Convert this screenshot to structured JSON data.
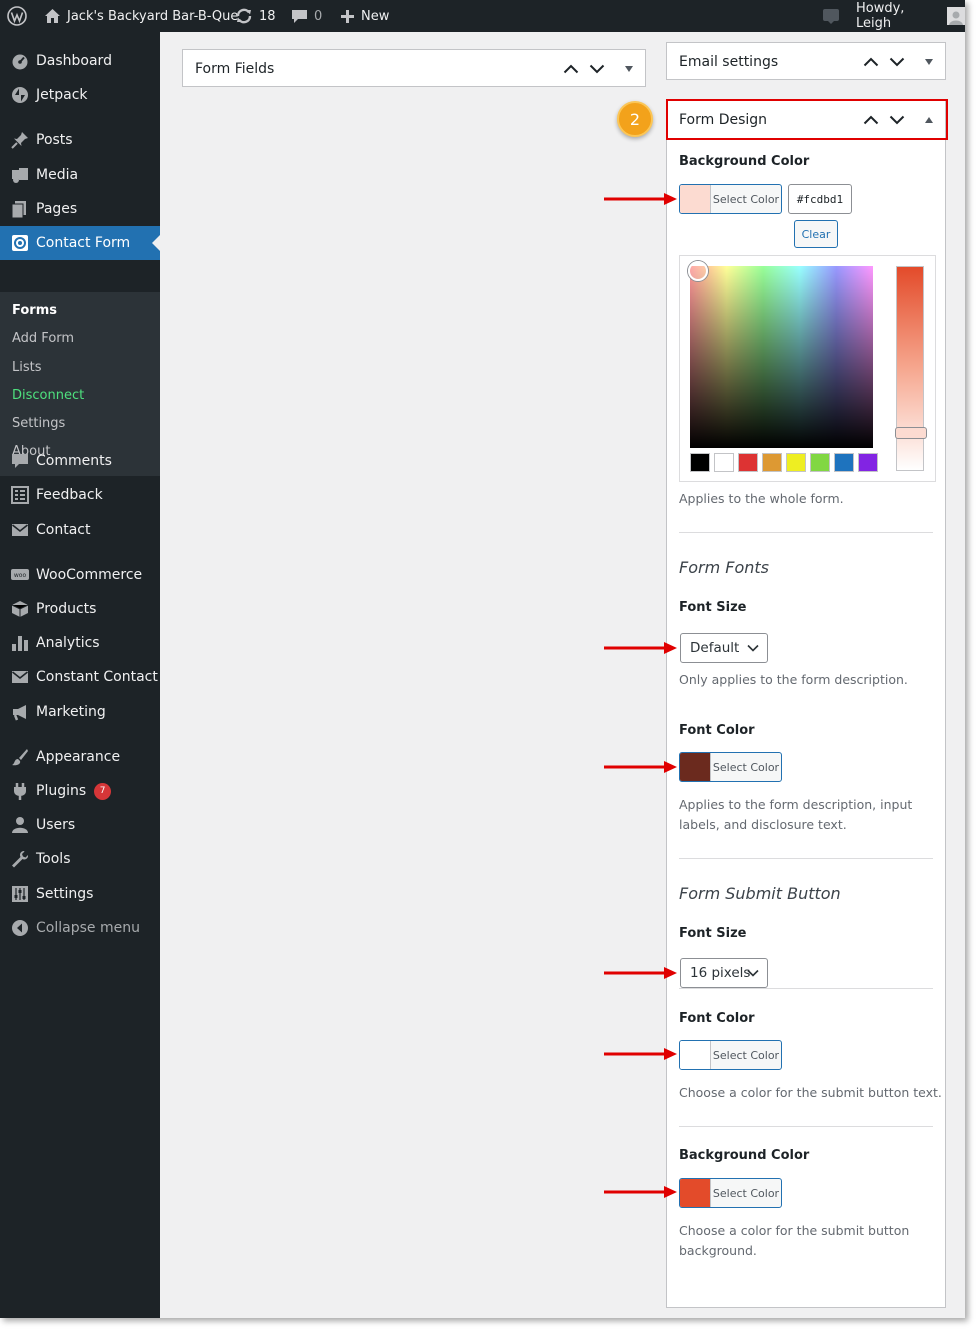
{
  "adminbar": {
    "site_name": "Jack's Backyard Bar-B-Que",
    "updates_count": "18",
    "comments_count": "0",
    "new_label": "New",
    "howdy": "Howdy, Leigh"
  },
  "sidebar": {
    "items": [
      {
        "label": "Dashboard",
        "icon": "dashboard-icon"
      },
      {
        "label": "Jetpack",
        "icon": "jetpack-icon"
      },
      {
        "label": "Posts",
        "icon": "pin-icon"
      },
      {
        "label": "Media",
        "icon": "media-icon"
      },
      {
        "label": "Pages",
        "icon": "pages-icon"
      },
      {
        "label": "Contact Form",
        "icon": "contact-form-icon"
      },
      {
        "label": "Comments",
        "icon": "comment-icon"
      },
      {
        "label": "Feedback",
        "icon": "feedback-icon"
      },
      {
        "label": "Contact",
        "icon": "mail-icon"
      },
      {
        "label": "WooCommerce",
        "icon": "woo-icon"
      },
      {
        "label": "Products",
        "icon": "products-icon"
      },
      {
        "label": "Analytics",
        "icon": "analytics-icon"
      },
      {
        "label": "Constant Contact",
        "icon": "mail-icon"
      },
      {
        "label": "Marketing",
        "icon": "megaphone-icon"
      },
      {
        "label": "Appearance",
        "icon": "brush-icon"
      },
      {
        "label": "Plugins",
        "icon": "plugin-icon",
        "badge": "7"
      },
      {
        "label": "Users",
        "icon": "users-icon"
      },
      {
        "label": "Tools",
        "icon": "wrench-icon"
      },
      {
        "label": "Settings",
        "icon": "settings-icon"
      },
      {
        "label": "Collapse menu",
        "icon": "collapse-icon"
      }
    ],
    "submenu": [
      "Forms",
      "Add Form",
      "Lists",
      "Disconnect",
      "Settings",
      "About"
    ]
  },
  "panels": {
    "form_fields": "Form Fields",
    "email_settings": "Email settings",
    "form_design": "Form Design"
  },
  "step_number": "2",
  "design": {
    "background_color_label": "Background Color",
    "select_color": "Select Color",
    "hex_value": "#fcdbd1",
    "clear": "Clear",
    "bg_help": "Applies to the whole form.",
    "form_fonts_title": "Form Fonts",
    "font_size_label": "Font Size",
    "font_size_value": "Default",
    "font_size_help": "Only applies to the form description.",
    "font_color_label": "Font Color",
    "font_color_help": "Applies to the form description, input labels, and disclosure text.",
    "submit_title": "Form Submit Button",
    "submit_font_size_label": "Font Size",
    "submit_font_size_value": "16 pixels",
    "submit_font_color_label": "Font Color",
    "submit_font_color_help": "Choose a color for the submit button text.",
    "submit_bg_label": "Background Color",
    "submit_bg_help": "Choose a color for the submit button background."
  },
  "colors": {
    "accent": "#2271b1",
    "form_bg": "#fcdbd1",
    "font_color": "#6b2a1e",
    "submit_font_color": "#ffffff",
    "submit_bg": "#e34b2a",
    "palette": [
      "#000000",
      "#ffffff",
      "#dd3333",
      "#dd9933",
      "#eeee22",
      "#81d742",
      "#1e73be",
      "#8224e3"
    ],
    "annotation_red": "#e00000",
    "step_orange": "#f3a21b"
  }
}
